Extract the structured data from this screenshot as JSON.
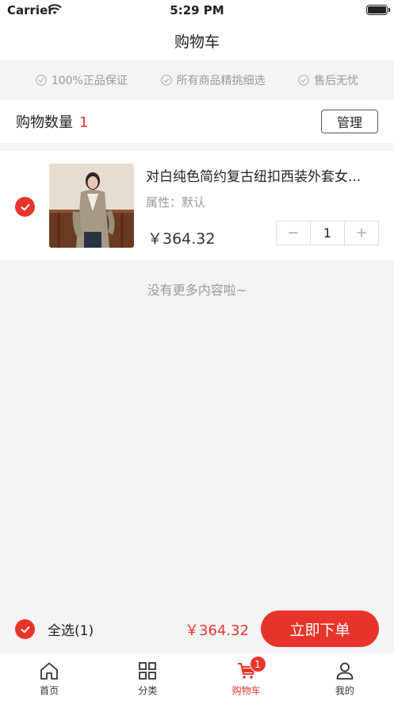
{
  "status_bar": {
    "carrier": "Carrier",
    "time": "5:29 PM"
  },
  "nav": {
    "title": "购物车"
  },
  "guarantees": [
    {
      "label": "100%正品保证",
      "icon": "check-circle-icon"
    },
    {
      "label": "所有商品精挑细选",
      "icon": "check-circle-icon"
    },
    {
      "label": "售后无忧",
      "icon": "check-circle-icon"
    }
  ],
  "summary": {
    "label": "购物数量",
    "count": "1",
    "manage_label": "管理"
  },
  "cart_items": [
    {
      "title": "对白纯色简约复古纽扣西装外套女...",
      "attribute": "属性：默认",
      "price": "￥364.32",
      "quantity": "1",
      "minus": "−",
      "plus": "+",
      "checked": true
    }
  ],
  "no_more_text": "没有更多内容啦~",
  "checkout": {
    "select_all_label": "全选(1)",
    "total": "￥364.32",
    "order_label": "立即下单"
  },
  "tabs": [
    {
      "label": "首页",
      "icon": "home-icon",
      "active": false
    },
    {
      "label": "分类",
      "icon": "grid-icon",
      "active": false
    },
    {
      "label": "购物车",
      "icon": "cart-icon",
      "active": true,
      "badge": "1"
    },
    {
      "label": "我的",
      "icon": "user-icon",
      "active": false
    }
  ],
  "colors": {
    "accent": "#e8352b",
    "background": "#f4f4f4"
  }
}
